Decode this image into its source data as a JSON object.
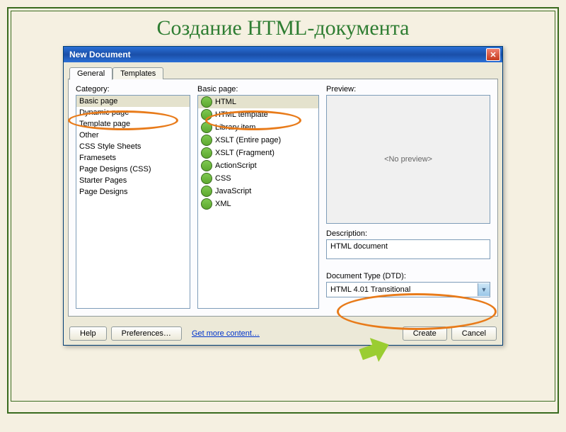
{
  "page": {
    "title": "Создание HTML-документа"
  },
  "dialog": {
    "title": "New Document"
  },
  "tabs": {
    "general": "General",
    "templates": "Templates"
  },
  "labels": {
    "category": "Category:",
    "basic_page": "Basic page:",
    "preview": "Preview:",
    "description": "Description:",
    "dtd": "Document Type (DTD):"
  },
  "category": {
    "items": [
      "Basic page",
      "Dynamic page",
      "Template page",
      "Other",
      "CSS Style Sheets",
      "Framesets",
      "Page Designs (CSS)",
      "Starter Pages",
      "Page Designs"
    ],
    "selected_index": 0
  },
  "basic_page": {
    "items": [
      "HTML",
      "HTML template",
      "Library item",
      "XSLT (Entire page)",
      "XSLT (Fragment)",
      "ActionScript",
      "CSS",
      "JavaScript",
      "XML"
    ],
    "selected_index": 0
  },
  "preview": {
    "placeholder": "<No preview>"
  },
  "description": {
    "value": "HTML document"
  },
  "dtd": {
    "value": "HTML 4.01 Transitional"
  },
  "buttons": {
    "help": "Help",
    "preferences": "Preferences…",
    "more_content": "Get more content…",
    "create": "Create",
    "cancel": "Cancel"
  }
}
